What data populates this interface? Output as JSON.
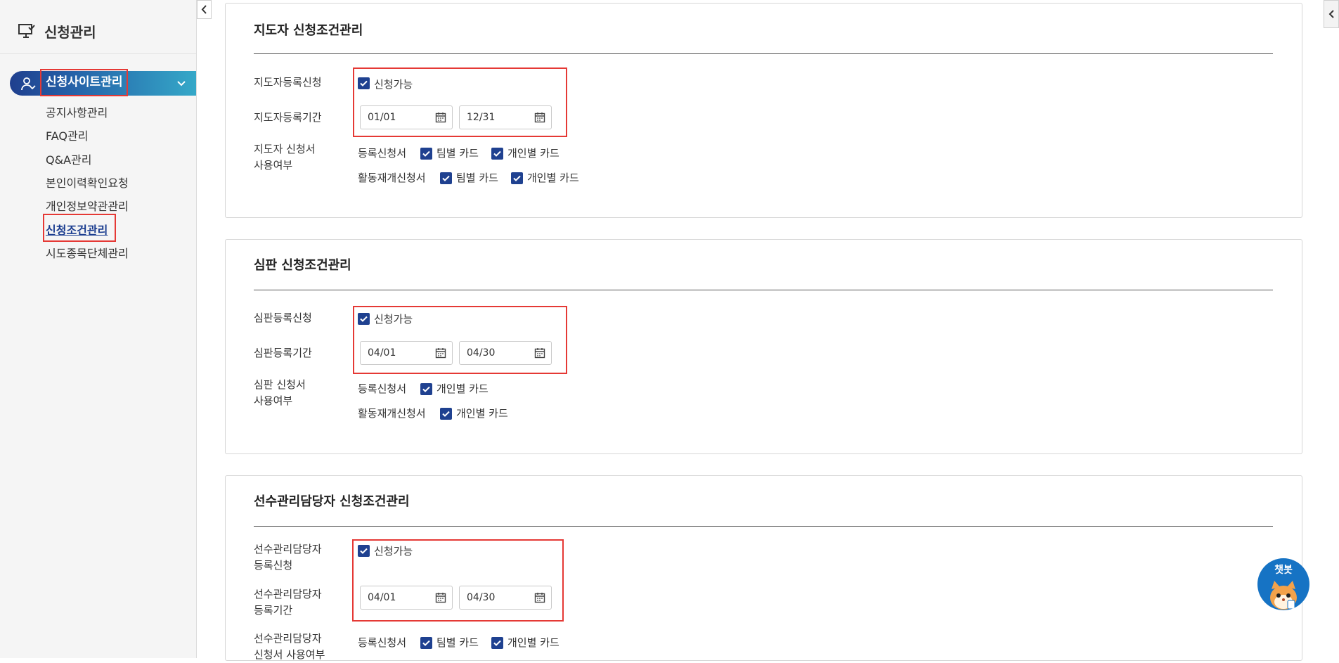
{
  "sidebar": {
    "title": "신청관리",
    "active_menu": "신청사이트관리",
    "items": [
      "공지사항관리",
      "FAQ관리",
      "Q&A관리",
      "본인이력확인요청",
      "개인정보약관관리",
      "신청조건관리",
      "시도종목단체관리"
    ],
    "current_item": "신청조건관리"
  },
  "common": {
    "available_label": "신청가능",
    "reg_form": "등록신청서",
    "renew_form": "활동재개신청서",
    "team_card": "팀별 카드",
    "personal_card": "개인별 카드"
  },
  "panels": [
    {
      "title": "지도자 신청조건관리",
      "reg_label": "지도자등록신청",
      "period_label": "지도자등록기간",
      "start": "01/01",
      "end": "12/31",
      "usage_label_1": "지도자 신청서",
      "usage_label_2": "사용여부"
    },
    {
      "title": "심판 신청조건관리",
      "reg_label": "심판등록신청",
      "period_label": "심판등록기간",
      "start": "04/01",
      "end": "04/30",
      "usage_label_1": "심판 신청서",
      "usage_label_2": "사용여부"
    },
    {
      "title": "선수관리담당자 신청조건관리",
      "reg_label_1": "선수관리담당자",
      "reg_label_2": "등록신청",
      "period_label_1": "선수관리담당자",
      "period_label_2": "등록기간",
      "start": "04/01",
      "end": "04/30",
      "usage_label_1": "선수관리담당자",
      "usage_label_2": "신청서 사용여부"
    }
  ],
  "chatbot": {
    "label": "챗봇"
  },
  "colors": {
    "accent": "#1f4190",
    "highlight": "#e53935",
    "menu_gradient_end": "#35a8c8"
  }
}
